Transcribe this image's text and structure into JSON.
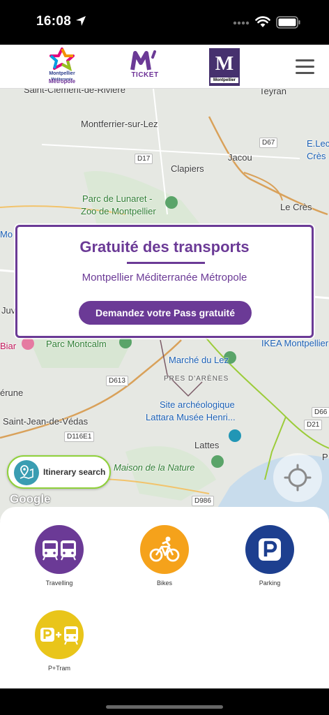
{
  "status_bar": {
    "time": "16:08"
  },
  "header": {
    "logo_metro_line1": "Montpellier",
    "logo_metro_line1b": "Méditerranée",
    "logo_metro_line2": "Métropole",
    "logo_ticket_text": "TICKET",
    "logo_mtp_letter": "M",
    "logo_mtp_text": "Montpellier"
  },
  "map": {
    "labels": {
      "st_clement": "Saint-Clément-de-Rivière",
      "teyran": "Teyran",
      "montferrier": "Montferrier-sur-Lez",
      "clapiers": "Clapiers",
      "jacou": "Jacou",
      "eleclerc": "E.Lec",
      "cres_short": "Crès",
      "parc_lunaret": "Parc de Lunaret -",
      "zoo": "Zoo de Montpellier",
      "le_cres": "Le Crès",
      "montpellier_left": "Mo",
      "juv": "Juv",
      "biar": "Biar",
      "parc_montcalm": "Parc Montcalm",
      "marche_lez": "Marché du Lez",
      "ikea": "IKEA Montpellier",
      "pres_arenes": "PRES D'ARÈNES",
      "erune": "érune",
      "site_archeo1": "Site archéologique",
      "site_archeo2": "Lattara Musée Henri...",
      "st_jean": "Saint-Jean-de-Védas",
      "lattes": "Lattes",
      "maison_nature": "Maison de la Nature",
      "p_right": "P"
    },
    "roads": {
      "d67": "D67",
      "d17": "D17",
      "d613": "D613",
      "d116e1": "D116E1",
      "d66": "D66",
      "d21": "D21",
      "d986": "D986"
    }
  },
  "promo": {
    "title": "Gratuité des transports",
    "subtitle": "Montpellier Méditerranée Métropole",
    "button": "Demandez votre Pass gratuité"
  },
  "itinerary": {
    "label": "Itinerary search"
  },
  "google_logo": "Google",
  "tiles": [
    {
      "label": "Travelling",
      "color": "#6b3a96"
    },
    {
      "label": "Bikes",
      "color": "#f5a21b"
    },
    {
      "label": "Parking",
      "color": "#1d3f8f"
    },
    {
      "label": "P+Tram",
      "color": "#e9c51a"
    }
  ],
  "colors": {
    "brand_purple": "#6b3a96",
    "itinerary_border": "#8fd13a"
  }
}
